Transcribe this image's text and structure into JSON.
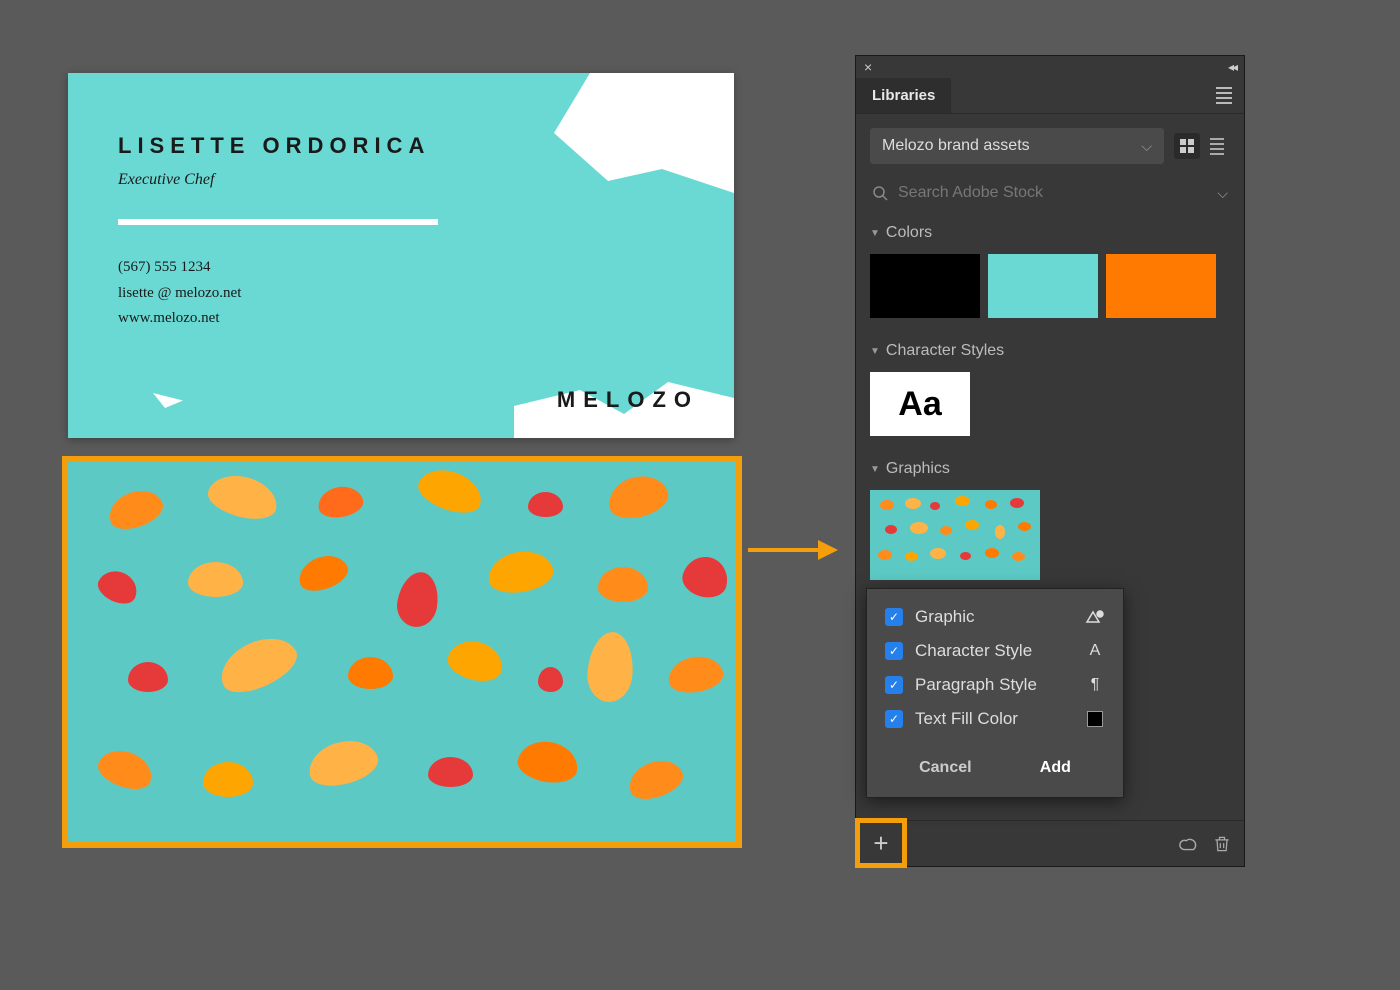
{
  "businessCard": {
    "name": "LISETTE ORDORICA",
    "title": "Executive Chef",
    "phone": "(567) 555 1234",
    "email": "lisette @ melozo.net",
    "website": "www.melozo.net",
    "logo": "MELOZO"
  },
  "panel": {
    "tabLabel": "Libraries",
    "librarySelect": {
      "selected": "Melozo brand assets"
    },
    "search": {
      "placeholder": "Search Adobe Stock"
    },
    "sections": {
      "colors": {
        "label": "Colors",
        "swatches": [
          "#000000",
          "#6ad9d4",
          "#ff7a00"
        ]
      },
      "characterStyles": {
        "label": "Character Styles",
        "sample": "Aa"
      },
      "graphics": {
        "label": "Graphics"
      }
    }
  },
  "popup": {
    "options": {
      "graphic": "Graphic",
      "characterStyle": "Character Style",
      "paragraphStyle": "Paragraph Style",
      "textFillColor": "Text Fill Color"
    },
    "buttons": {
      "cancel": "Cancel",
      "add": "Add"
    }
  }
}
